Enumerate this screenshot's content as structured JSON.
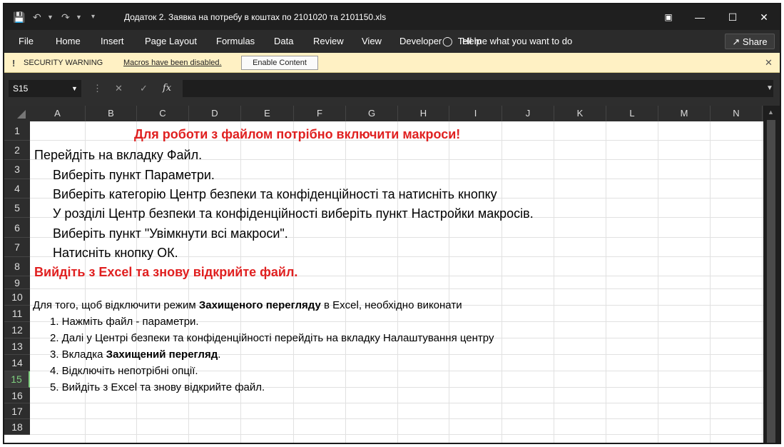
{
  "titlebar": {
    "document_title": "Додаток 2. Заявка на потребу в коштах по 2101020 та 2101150.xls"
  },
  "ribbon": {
    "tabs": [
      "File",
      "Home",
      "Insert",
      "Page Layout",
      "Formulas",
      "Data",
      "Review",
      "View",
      "Developer",
      "Help"
    ],
    "tell_me": "Tell me what you want to do",
    "share": "Share"
  },
  "security_bar": {
    "icon": "!",
    "label": "SECURITY WARNING",
    "message": "Macros have been disabled.",
    "button": "Enable Content"
  },
  "formula_bar": {
    "name_box": "S15",
    "formula": ""
  },
  "sheet": {
    "columns": [
      "A",
      "B",
      "C",
      "D",
      "E",
      "F",
      "G",
      "H",
      "I",
      "J",
      "K",
      "L",
      "M",
      "N"
    ],
    "rows": [
      "1",
      "2",
      "3",
      "4",
      "5",
      "6",
      "7",
      "8",
      "9",
      "10",
      "11",
      "12",
      "13",
      "14",
      "15",
      "16",
      "17",
      "18"
    ],
    "selected_row": "15",
    "cells": {
      "r1": "Для роботи з файлом потрібно включити макроси!",
      "r2": "Перейдіть на вкладку Файл.",
      "r3": "Виберіть пункт Параметри.",
      "r4": "Виберіть категорію Центр безпеки та конфіденційності та натисніть кнопку",
      "r5": "У розділі Центр безпеки та конфіденційності виберіть пункт Настройки макросів.",
      "r6": "Виберіть пункт \"Увімкнути всі макроси\".",
      "r7": "Натисніть кнопку ОК.",
      "r8": "Вийдіть з Excel та знову відкрийте файл.",
      "r10_a": "Для того, щоб відключити режим ",
      "r10_b": "Захищеного перегляду",
      "r10_c": " в Excel, необхідно виконати",
      "r11": "1. Нажміть файл - параметри.",
      "r12": "2. Далі у Центрі безпеки та конфіденційності перейдіть на вкладку Налаштування центру",
      "r13_a": "3. Вкладка ",
      "r13_b": "Захищений перегляд",
      "r13_c": ".",
      "r14": "4. Відключіть непотрібні опції.",
      "r15": "5. Вийдіть з Excel та знову відкрийте файл."
    }
  }
}
